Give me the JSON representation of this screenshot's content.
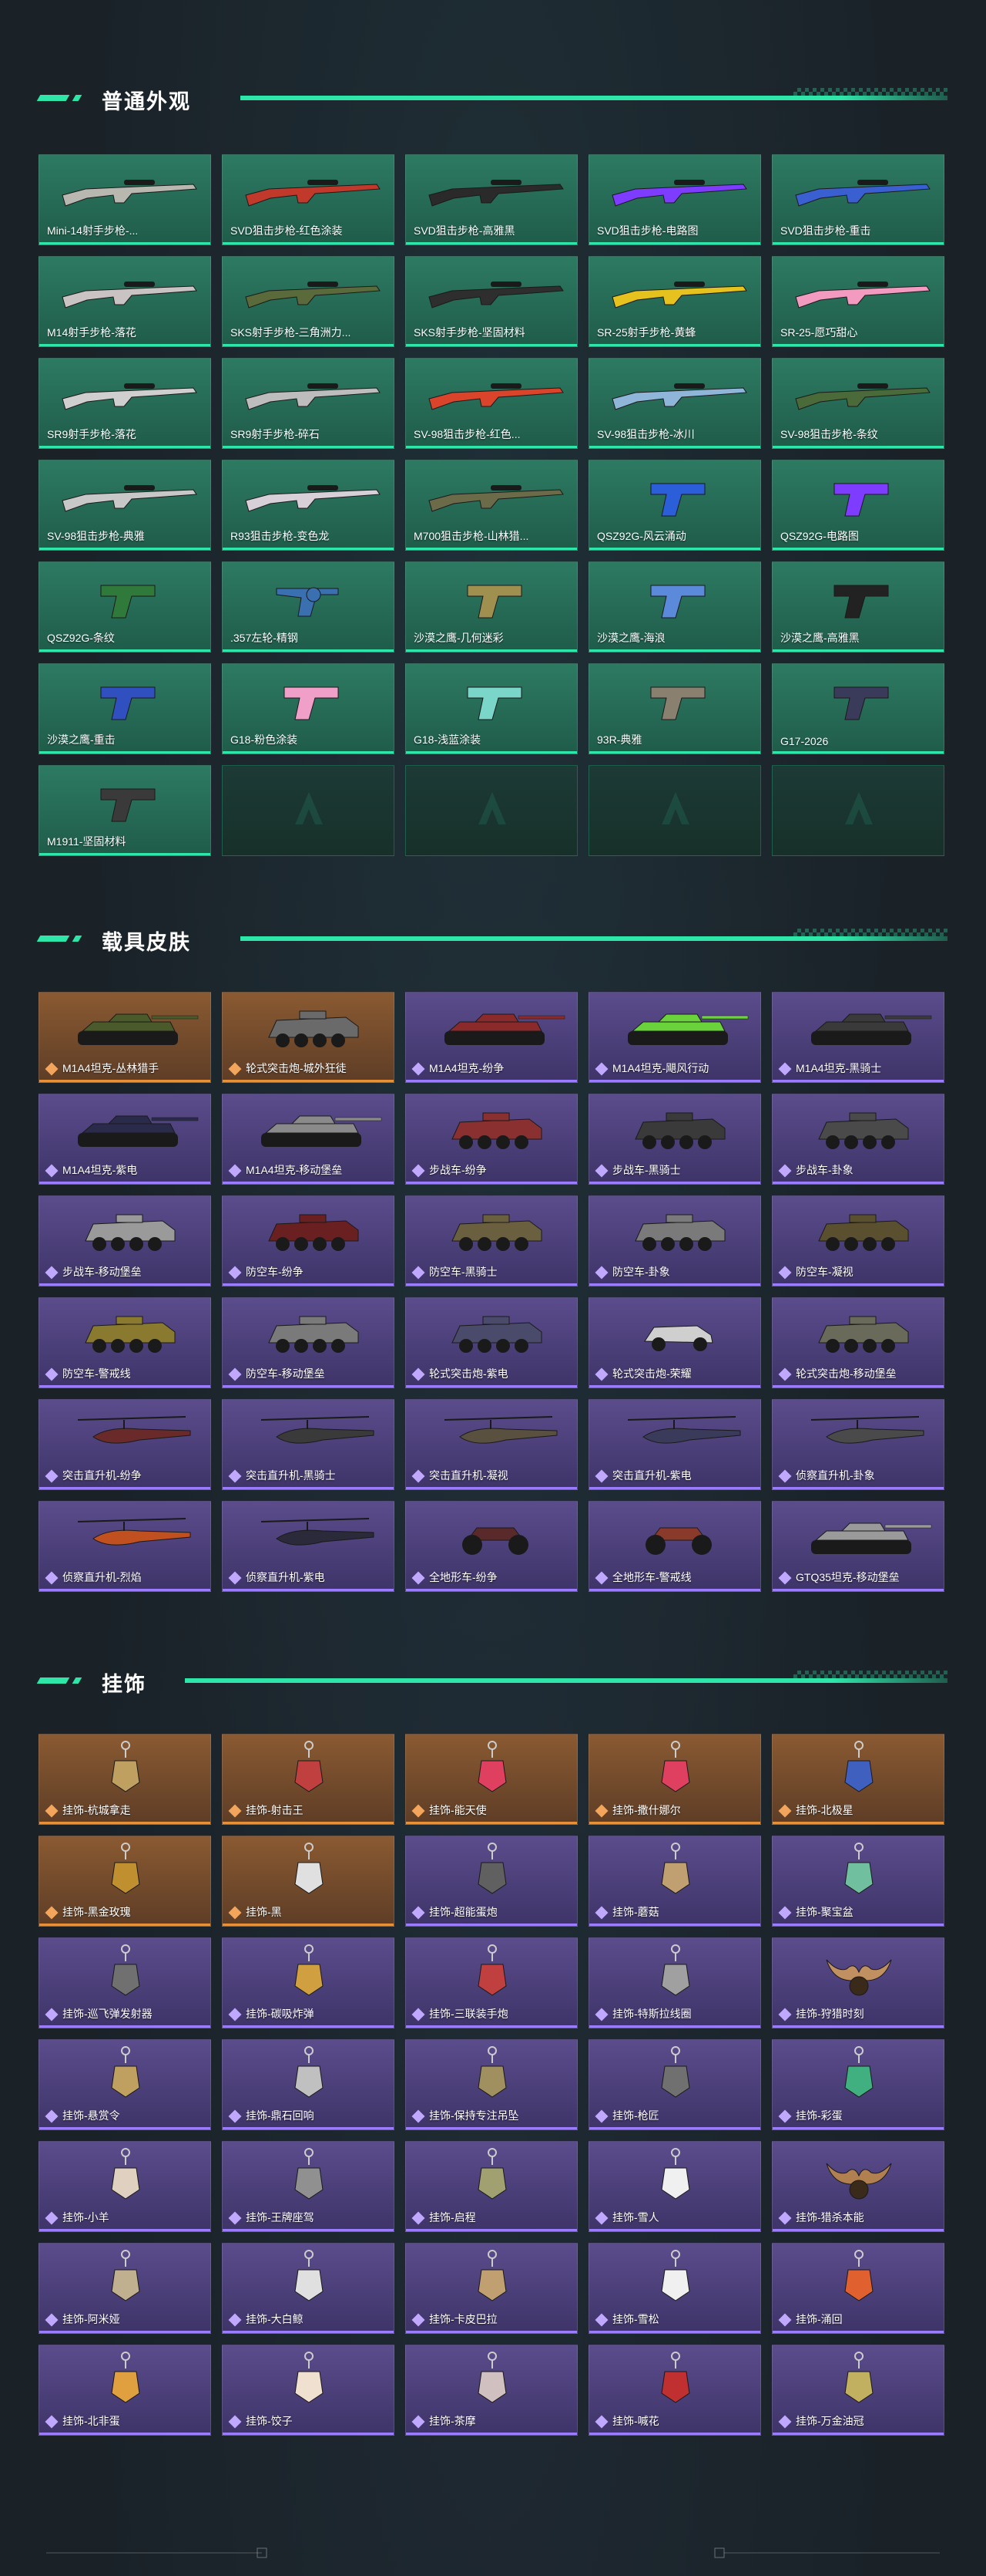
{
  "sections": [
    {
      "title": "普通外观",
      "items": [
        {
          "label": "Mini-14射手步枪-...",
          "kind": "rifle",
          "color": "#b8b8b0"
        },
        {
          "label": "SVD狙击步枪-红色涂装",
          "kind": "rifle",
          "color": "#c0392b"
        },
        {
          "label": "SVD狙击步枪-高雅黑",
          "kind": "rifle",
          "color": "#2a2a2a"
        },
        {
          "label": "SVD狙击步枪-电路图",
          "kind": "rifle",
          "color": "#7d3cff"
        },
        {
          "label": "SVD狙击步枪-重击",
          "kind": "rifle",
          "color": "#3a5fd0"
        },
        {
          "label": "M14射手步枪-落花",
          "kind": "rifle",
          "color": "#c9c3c3"
        },
        {
          "label": "SKS射手步枪-三角洲力...",
          "kind": "rifle",
          "color": "#5a6a3a"
        },
        {
          "label": "SKS射手步枪-坚固材料",
          "kind": "rifle",
          "color": "#2e2e2e"
        },
        {
          "label": "SR-25射手步枪-黄蜂",
          "kind": "rifle",
          "color": "#e6c21e"
        },
        {
          "label": "SR-25-愿巧甜心",
          "kind": "rifle",
          "color": "#f29ac0"
        },
        {
          "label": "SR9射手步枪-落花",
          "kind": "rifle",
          "color": "#cfcfcf"
        },
        {
          "label": "SR9射手步枪-碎石",
          "kind": "rifle",
          "color": "#bdbdbd"
        },
        {
          "label": "SV-98狙击步枪-红色...",
          "kind": "rifle",
          "color": "#d9442b"
        },
        {
          "label": "SV-98狙击步枪-冰川",
          "kind": "rifle",
          "color": "#8fb6d9"
        },
        {
          "label": "SV-98狙击步枪-条纹",
          "kind": "rifle",
          "color": "#4a6a3a"
        },
        {
          "label": "SV-98狙击步枪-典雅",
          "kind": "rifle",
          "color": "#c8c8c8"
        },
        {
          "label": "R93狙击步枪-变色龙",
          "kind": "rifle",
          "color": "#d8d0d8"
        },
        {
          "label": "M700狙击步枪-山林猎...",
          "kind": "rifle",
          "color": "#6b6b4a"
        },
        {
          "label": "QSZ92G-风云涌动",
          "kind": "pistol",
          "color": "#2a5fd9"
        },
        {
          "label": "QSZ92G-电路图",
          "kind": "pistol",
          "color": "#7d3cff"
        },
        {
          "label": "QSZ92G-条纹",
          "kind": "pistol",
          "color": "#2f7a3a"
        },
        {
          "label": ".357左轮-精钢",
          "kind": "revolver",
          "color": "#3a6fb0"
        },
        {
          "label": "沙漠之鹰-几何迷彩",
          "kind": "pistol",
          "color": "#a09050"
        },
        {
          "label": "沙漠之鹰-海浪",
          "kind": "pistol",
          "color": "#5a8ad9"
        },
        {
          "label": "沙漠之鹰-高雅黑",
          "kind": "pistol",
          "color": "#222222"
        },
        {
          "label": "沙漠之鹰-重击",
          "kind": "pistol",
          "color": "#3050c0"
        },
        {
          "label": "G18-粉色涂装",
          "kind": "pistol",
          "color": "#f0a0c8"
        },
        {
          "label": "G18-浅蓝涂装",
          "kind": "pistol",
          "color": "#7ad6c8"
        },
        {
          "label": "93R-典雅",
          "kind": "pistol",
          "color": "#8a8070"
        },
        {
          "label": "G17-2026",
          "kind": "pistol",
          "color": "#3a3a5a"
        },
        {
          "label": "M1911-坚固材料",
          "kind": "pistol",
          "color": "#3a3a3a"
        },
        {
          "label": "",
          "kind": "empty",
          "color": ""
        },
        {
          "label": "",
          "kind": "empty",
          "color": ""
        },
        {
          "label": "",
          "kind": "empty",
          "color": ""
        },
        {
          "label": "",
          "kind": "empty",
          "color": ""
        }
      ]
    },
    {
      "title": "载具皮肤",
      "items": [
        {
          "label": "M1A4坦克-丛林猎手",
          "kind": "tank",
          "color": "#4a5a2a",
          "tier": "orange"
        },
        {
          "label": "轮式突击炮-城外狂徒",
          "kind": "apc",
          "color": "#6a6a6a",
          "tier": "orange"
        },
        {
          "label": "M1A4坦克-纷争",
          "kind": "tank",
          "color": "#8a2a2a",
          "tier": "purple"
        },
        {
          "label": "M1A4坦克-飓风行动",
          "kind": "tank",
          "color": "#6ad23a",
          "tier": "purple"
        },
        {
          "label": "M1A4坦克-黑骑士",
          "kind": "tank",
          "color": "#3a3a3a",
          "tier": "purple"
        },
        {
          "label": "M1A4坦克-紫电",
          "kind": "tank",
          "color": "#2a2a4a",
          "tier": "purple"
        },
        {
          "label": "M1A4坦克-移动堡垒",
          "kind": "tank",
          "color": "#8a8a8a",
          "tier": "purple"
        },
        {
          "label": "步战车-纷争",
          "kind": "apc",
          "color": "#8a3030",
          "tier": "purple"
        },
        {
          "label": "步战车-黑骑士",
          "kind": "apc",
          "color": "#3a3a3a",
          "tier": "purple"
        },
        {
          "label": "步战车-卦象",
          "kind": "apc",
          "color": "#4a4a4a",
          "tier": "purple"
        },
        {
          "label": "步战车-移动堡垒",
          "kind": "apc",
          "color": "#9a9a9a",
          "tier": "purple"
        },
        {
          "label": "防空车-纷争",
          "kind": "apc",
          "color": "#6a2020",
          "tier": "purple"
        },
        {
          "label": "防空车-黑骑士",
          "kind": "apc",
          "color": "#6a6040",
          "tier": "purple"
        },
        {
          "label": "防空车-卦象",
          "kind": "apc",
          "color": "#7a7a7a",
          "tier": "purple"
        },
        {
          "label": "防空车-凝视",
          "kind": "apc",
          "color": "#5a5030",
          "tier": "purple"
        },
        {
          "label": "防空车-警戒线",
          "kind": "apc",
          "color": "#8a7a30",
          "tier": "purple"
        },
        {
          "label": "防空车-移动堡垒",
          "kind": "apc",
          "color": "#7a7a7a",
          "tier": "purple"
        },
        {
          "label": "轮式突击炮-紫电",
          "kind": "apc",
          "color": "#4a4a6a",
          "tier": "purple"
        },
        {
          "label": "轮式突击炮-荣耀",
          "kind": "car",
          "color": "#cfcfcf",
          "tier": "purple"
        },
        {
          "label": "轮式突击炮-移动堡垒",
          "kind": "apc",
          "color": "#6a6a5a",
          "tier": "purple"
        },
        {
          "label": "突击直升机-纷争",
          "kind": "heli",
          "color": "#6a2a2a",
          "tier": "purple"
        },
        {
          "label": "突击直升机-黑骑士",
          "kind": "heli",
          "color": "#3a3a3a",
          "tier": "purple"
        },
        {
          "label": "突击直升机-凝视",
          "kind": "heli",
          "color": "#5a5040",
          "tier": "purple"
        },
        {
          "label": "突击直升机-紫电",
          "kind": "heli",
          "color": "#3a3a5a",
          "tier": "purple"
        },
        {
          "label": "侦察直升机-卦象",
          "kind": "heli",
          "color": "#4a4a4a",
          "tier": "purple"
        },
        {
          "label": "侦察直升机-烈焰",
          "kind": "heli",
          "color": "#c05020",
          "tier": "purple"
        },
        {
          "label": "侦察直升机-紫电",
          "kind": "heli",
          "color": "#2a2a3a",
          "tier": "purple"
        },
        {
          "label": "全地形车-纷争",
          "kind": "atv",
          "color": "#5a2a2a",
          "tier": "purple"
        },
        {
          "label": "全地形车-警戒线",
          "kind": "atv",
          "color": "#8a3a2a",
          "tier": "purple"
        },
        {
          "label": "GTQ35坦克-移动堡垒",
          "kind": "tank",
          "color": "#9a9a9a",
          "tier": "purple"
        }
      ]
    },
    {
      "title": "挂饰",
      "items": [
        {
          "label": "挂饰-杭城拿走",
          "kind": "charm",
          "color": "#c0a060",
          "tier": "orange"
        },
        {
          "label": "挂饰-射击王",
          "kind": "charm",
          "color": "#c04040",
          "tier": "orange"
        },
        {
          "label": "挂饰-能天使",
          "kind": "charm",
          "color": "#e04060",
          "tier": "orange"
        },
        {
          "label": "挂饰-撒什娜尔",
          "kind": "charm",
          "color": "#e04060",
          "tier": "orange"
        },
        {
          "label": "挂饰-北极星",
          "kind": "charm",
          "color": "#4060c0",
          "tier": "orange"
        },
        {
          "label": "挂饰-黑金玫瑰",
          "kind": "charm",
          "color": "#c09030",
          "tier": "orange"
        },
        {
          "label": "挂饰-黑",
          "kind": "charm",
          "color": "#e0e0e0",
          "tier": "orange"
        },
        {
          "label": "挂饰-超能蛋炮",
          "kind": "charm",
          "color": "#606060",
          "tier": "purple"
        },
        {
          "label": "挂饰-蘑菇",
          "kind": "charm",
          "color": "#c0a070",
          "tier": "purple"
        },
        {
          "label": "挂饰-聚宝盆",
          "kind": "charm",
          "color": "#70c0a0",
          "tier": "purple"
        },
        {
          "label": "挂饰-巡飞弹发射器",
          "kind": "charm",
          "color": "#707070",
          "tier": "purple"
        },
        {
          "label": "挂饰-碳吸炸弹",
          "kind": "charm",
          "color": "#d0a040",
          "tier": "purple"
        },
        {
          "label": "挂饰-三联装手炮",
          "kind": "charm",
          "color": "#c04040",
          "tier": "purple"
        },
        {
          "label": "挂饰-特斯拉线圈",
          "kind": "charm",
          "color": "#a0a0a0",
          "tier": "purple"
        },
        {
          "label": "挂饰-狩猎时刻",
          "kind": "antler",
          "color": "#c09060",
          "tier": "purple"
        },
        {
          "label": "挂饰-悬赏令",
          "kind": "charm",
          "color": "#c0a060",
          "tier": "purple"
        },
        {
          "label": "挂饰-鼎石回响",
          "kind": "charm",
          "color": "#c0c0c0",
          "tier": "purple"
        },
        {
          "label": "挂饰-保持专注吊坠",
          "kind": "charm",
          "color": "#a09060",
          "tier": "purple"
        },
        {
          "label": "挂饰-枪匠",
          "kind": "charm",
          "color": "#707070",
          "tier": "purple"
        },
        {
          "label": "挂饰-彩蛋",
          "kind": "charm",
          "color": "#40b080",
          "tier": "purple"
        },
        {
          "label": "挂饰-小羊",
          "kind": "charm",
          "color": "#e0d0c0",
          "tier": "purple"
        },
        {
          "label": "挂饰-王牌座驾",
          "kind": "charm",
          "color": "#909090",
          "tier": "purple"
        },
        {
          "label": "挂饰-启程",
          "kind": "charm",
          "color": "#a0a070",
          "tier": "purple"
        },
        {
          "label": "挂饰-雪人",
          "kind": "charm",
          "color": "#f0f0f0",
          "tier": "purple"
        },
        {
          "label": "挂饰-猎杀本能",
          "kind": "antler",
          "color": "#b08050",
          "tier": "purple"
        },
        {
          "label": "挂饰-阿米娅",
          "kind": "charm",
          "color": "#c0b090",
          "tier": "purple"
        },
        {
          "label": "挂饰-大白鲸",
          "kind": "charm",
          "color": "#e0e0e0",
          "tier": "purple"
        },
        {
          "label": "挂饰-卡皮巴拉",
          "kind": "charm",
          "color": "#c0a070",
          "tier": "purple"
        },
        {
          "label": "挂饰-雪松",
          "kind": "charm",
          "color": "#f0f0f0",
          "tier": "purple"
        },
        {
          "label": "挂饰-涌回",
          "kind": "charm",
          "color": "#e06030",
          "tier": "purple"
        },
        {
          "label": "挂饰-北非蛋",
          "kind": "charm",
          "color": "#e0a040",
          "tier": "purple"
        },
        {
          "label": "挂饰-饺子",
          "kind": "charm",
          "color": "#f0e0d0",
          "tier": "purple"
        },
        {
          "label": "挂饰-茶摩",
          "kind": "charm",
          "color": "#d0c0c0",
          "tier": "purple"
        },
        {
          "label": "挂饰-喊花",
          "kind": "charm",
          "color": "#c03030",
          "tier": "purple"
        },
        {
          "label": "挂饰-万金油冠",
          "kind": "charm",
          "color": "#c0b060",
          "tier": "purple"
        }
      ]
    }
  ]
}
